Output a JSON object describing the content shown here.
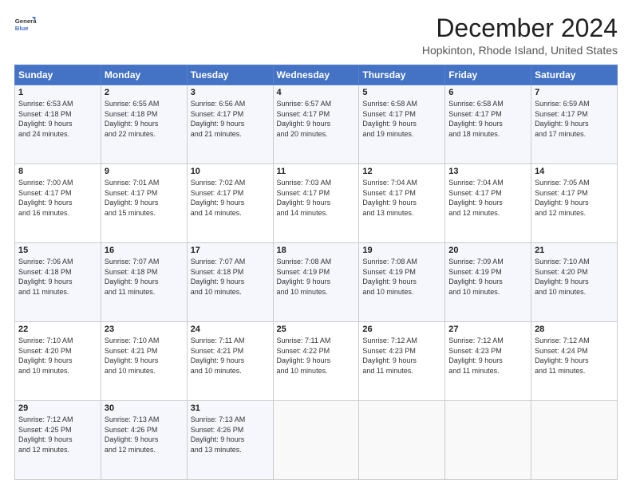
{
  "brand": {
    "line1": "General",
    "line2": "Blue"
  },
  "title": "December 2024",
  "subtitle": "Hopkinton, Rhode Island, United States",
  "days_of_week": [
    "Sunday",
    "Monday",
    "Tuesday",
    "Wednesday",
    "Thursday",
    "Friday",
    "Saturday"
  ],
  "weeks": [
    [
      {
        "day": "1",
        "info": "Sunrise: 6:53 AM\nSunset: 4:18 PM\nDaylight: 9 hours\nand 24 minutes."
      },
      {
        "day": "2",
        "info": "Sunrise: 6:55 AM\nSunset: 4:18 PM\nDaylight: 9 hours\nand 22 minutes."
      },
      {
        "day": "3",
        "info": "Sunrise: 6:56 AM\nSunset: 4:17 PM\nDaylight: 9 hours\nand 21 minutes."
      },
      {
        "day": "4",
        "info": "Sunrise: 6:57 AM\nSunset: 4:17 PM\nDaylight: 9 hours\nand 20 minutes."
      },
      {
        "day": "5",
        "info": "Sunrise: 6:58 AM\nSunset: 4:17 PM\nDaylight: 9 hours\nand 19 minutes."
      },
      {
        "day": "6",
        "info": "Sunrise: 6:58 AM\nSunset: 4:17 PM\nDaylight: 9 hours\nand 18 minutes."
      },
      {
        "day": "7",
        "info": "Sunrise: 6:59 AM\nSunset: 4:17 PM\nDaylight: 9 hours\nand 17 minutes."
      }
    ],
    [
      {
        "day": "8",
        "info": "Sunrise: 7:00 AM\nSunset: 4:17 PM\nDaylight: 9 hours\nand 16 minutes."
      },
      {
        "day": "9",
        "info": "Sunrise: 7:01 AM\nSunset: 4:17 PM\nDaylight: 9 hours\nand 15 minutes."
      },
      {
        "day": "10",
        "info": "Sunrise: 7:02 AM\nSunset: 4:17 PM\nDaylight: 9 hours\nand 14 minutes."
      },
      {
        "day": "11",
        "info": "Sunrise: 7:03 AM\nSunset: 4:17 PM\nDaylight: 9 hours\nand 14 minutes."
      },
      {
        "day": "12",
        "info": "Sunrise: 7:04 AM\nSunset: 4:17 PM\nDaylight: 9 hours\nand 13 minutes."
      },
      {
        "day": "13",
        "info": "Sunrise: 7:04 AM\nSunset: 4:17 PM\nDaylight: 9 hours\nand 12 minutes."
      },
      {
        "day": "14",
        "info": "Sunrise: 7:05 AM\nSunset: 4:17 PM\nDaylight: 9 hours\nand 12 minutes."
      }
    ],
    [
      {
        "day": "15",
        "info": "Sunrise: 7:06 AM\nSunset: 4:18 PM\nDaylight: 9 hours\nand 11 minutes."
      },
      {
        "day": "16",
        "info": "Sunrise: 7:07 AM\nSunset: 4:18 PM\nDaylight: 9 hours\nand 11 minutes."
      },
      {
        "day": "17",
        "info": "Sunrise: 7:07 AM\nSunset: 4:18 PM\nDaylight: 9 hours\nand 10 minutes."
      },
      {
        "day": "18",
        "info": "Sunrise: 7:08 AM\nSunset: 4:19 PM\nDaylight: 9 hours\nand 10 minutes."
      },
      {
        "day": "19",
        "info": "Sunrise: 7:08 AM\nSunset: 4:19 PM\nDaylight: 9 hours\nand 10 minutes."
      },
      {
        "day": "20",
        "info": "Sunrise: 7:09 AM\nSunset: 4:19 PM\nDaylight: 9 hours\nand 10 minutes."
      },
      {
        "day": "21",
        "info": "Sunrise: 7:10 AM\nSunset: 4:20 PM\nDaylight: 9 hours\nand 10 minutes."
      }
    ],
    [
      {
        "day": "22",
        "info": "Sunrise: 7:10 AM\nSunset: 4:20 PM\nDaylight: 9 hours\nand 10 minutes."
      },
      {
        "day": "23",
        "info": "Sunrise: 7:10 AM\nSunset: 4:21 PM\nDaylight: 9 hours\nand 10 minutes."
      },
      {
        "day": "24",
        "info": "Sunrise: 7:11 AM\nSunset: 4:21 PM\nDaylight: 9 hours\nand 10 minutes."
      },
      {
        "day": "25",
        "info": "Sunrise: 7:11 AM\nSunset: 4:22 PM\nDaylight: 9 hours\nand 10 minutes."
      },
      {
        "day": "26",
        "info": "Sunrise: 7:12 AM\nSunset: 4:23 PM\nDaylight: 9 hours\nand 11 minutes."
      },
      {
        "day": "27",
        "info": "Sunrise: 7:12 AM\nSunset: 4:23 PM\nDaylight: 9 hours\nand 11 minutes."
      },
      {
        "day": "28",
        "info": "Sunrise: 7:12 AM\nSunset: 4:24 PM\nDaylight: 9 hours\nand 11 minutes."
      }
    ],
    [
      {
        "day": "29",
        "info": "Sunrise: 7:12 AM\nSunset: 4:25 PM\nDaylight: 9 hours\nand 12 minutes."
      },
      {
        "day": "30",
        "info": "Sunrise: 7:13 AM\nSunset: 4:26 PM\nDaylight: 9 hours\nand 12 minutes."
      },
      {
        "day": "31",
        "info": "Sunrise: 7:13 AM\nSunset: 4:26 PM\nDaylight: 9 hours\nand 13 minutes."
      },
      null,
      null,
      null,
      null
    ]
  ]
}
